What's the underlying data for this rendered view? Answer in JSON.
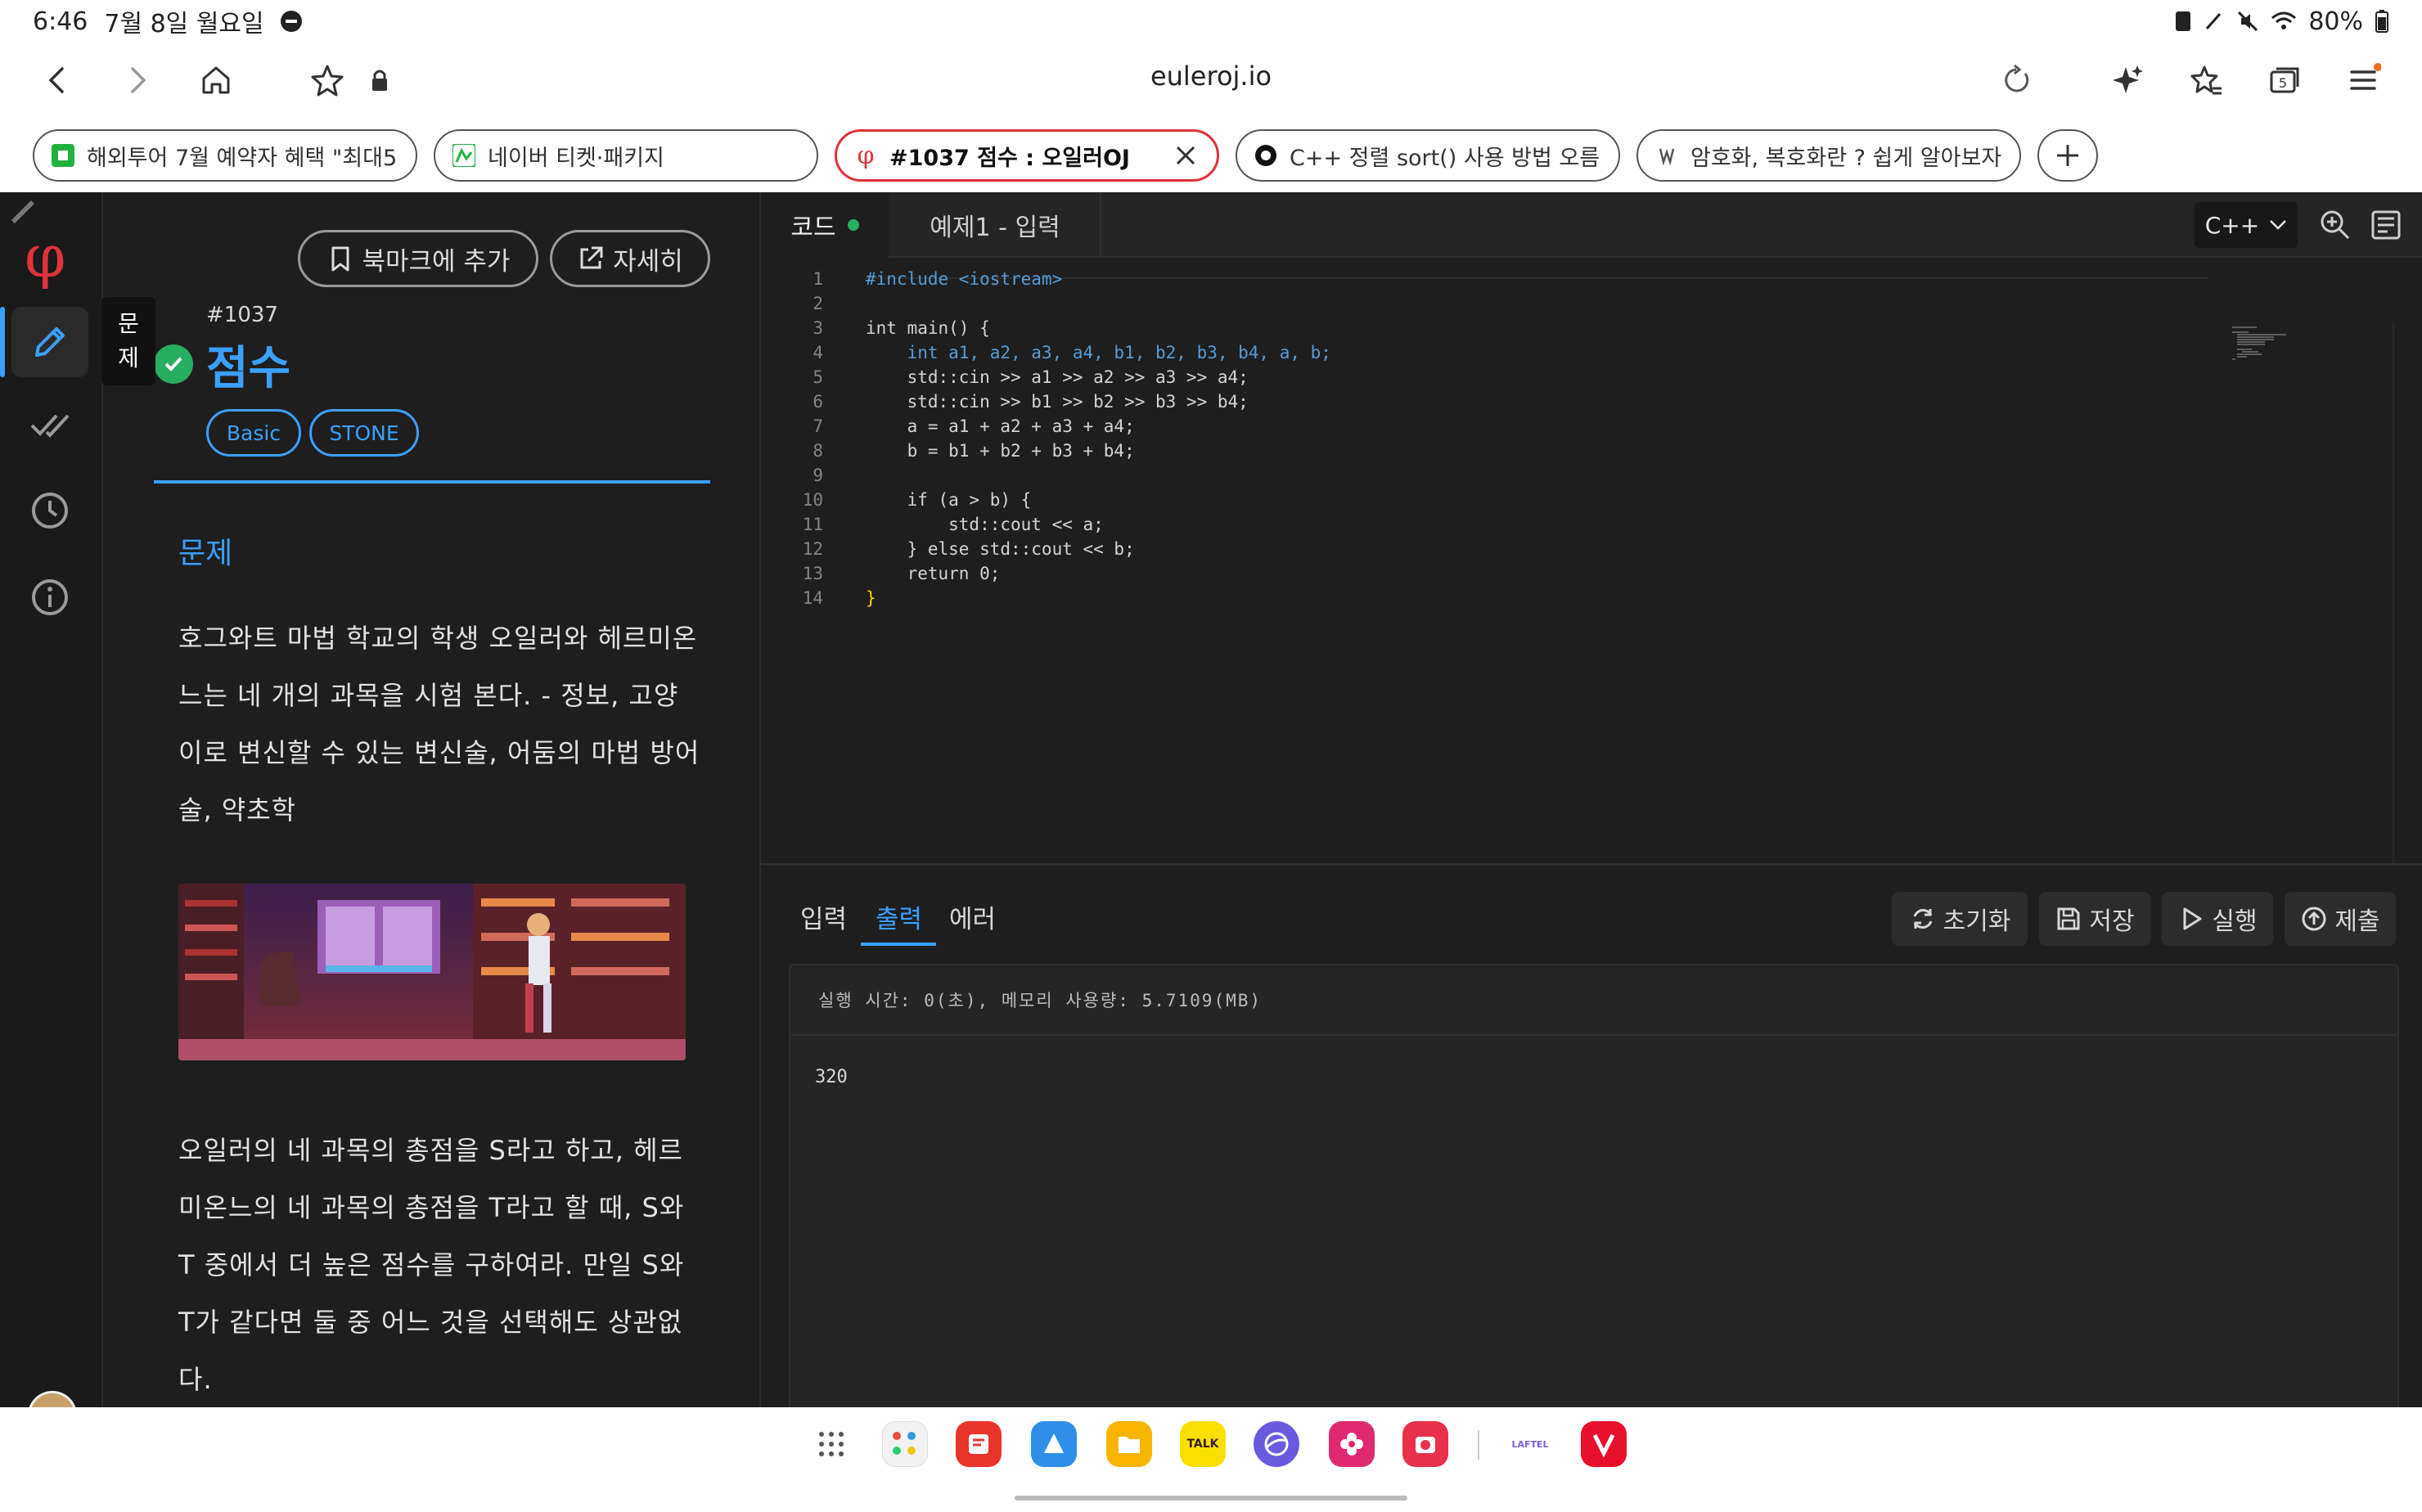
{
  "status_bar": {
    "time": "6:46",
    "date": "7월 8일 월요일",
    "battery": "80%"
  },
  "browser": {
    "url": "euleroj.io",
    "tab_count": "5",
    "tabs": [
      {
        "title": "해외투어 7월 예약자 혜택 \"최대5...",
        "active": false
      },
      {
        "title": "네이버 티켓·패키지",
        "active": false
      },
      {
        "title": "#1037 점수 : 오일러OJ",
        "active": true
      },
      {
        "title": "C++ 정렬 sort() 사용 방법 오름 ...",
        "active": false
      },
      {
        "title": "암호화, 복호화란 ? 쉽게 알아보자.",
        "active": false
      }
    ]
  },
  "sidebar": {
    "logo": "φ",
    "tooltip_line1": "문",
    "tooltip_line2": "제"
  },
  "problem": {
    "bookmark_label": "북마크에 추가",
    "details_label": "자세히",
    "number": "#1037",
    "title": "점수",
    "tags": [
      "Basic",
      "STONE"
    ],
    "section_title": "문제",
    "paragraph1": "호그와트 마법 학교의 학생 오일러와 헤르미온느는 네 개의 과목을 시험 본다. - 정보, 고양이로 변신할 수 있는 변신술, 어둠의 마법 방어술, 약초학",
    "paragraph2": "오일러의 네 과목의 총점을 S라고 하고, 헤르미온느의 네 과목의 총점을 T라고 할 때, S와 T 중에서 더 높은 점수를 구하여라. 만일 S와 T가 같다면 둘 중 어느 것을 선택해도 상관없다."
  },
  "editor": {
    "tab_code": "코드",
    "tab_example": "예제1 - 입력",
    "language": "C++",
    "lines": [
      "#include <iostream>",
      "",
      "int main() {",
      "    int a1, a2, a3, a4, b1, b2, b3, b4, a, b;",
      "    std::cin >> a1 >> a2 >> a3 >> a4;",
      "    std::cin >> b1 >> b2 >> b3 >> b4;",
      "    a = a1 + a2 + a3 + a4;",
      "    b = b1 + b2 + b3 + b4;",
      "",
      "    if (a > b) {",
      "        std::cout << a;",
      "    } else std::cout << b;",
      "    return 0;",
      "}"
    ]
  },
  "io": {
    "tab_input": "입력",
    "tab_output": "출력",
    "tab_error": "에러",
    "reset_label": "초기화",
    "save_label": "저장",
    "run_label": "실행",
    "submit_label": "제출",
    "exec_info": "실행 시간: 0(초), 메모리 사용량: 5.7109(MB)",
    "output": "320"
  },
  "dock": {
    "laftel_label": "LAFTEL",
    "talk_label": "TALK"
  }
}
